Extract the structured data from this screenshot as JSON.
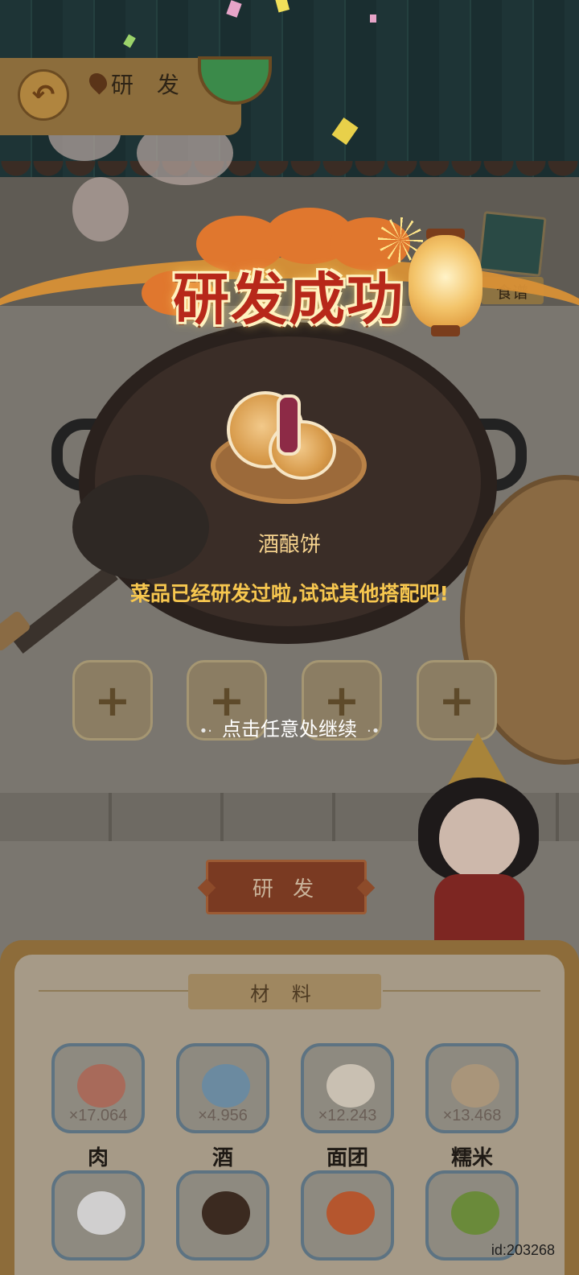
{
  "header": {
    "title": "研 发",
    "back_icon": "back-arrow-icon",
    "location_icon": "location-pin-icon"
  },
  "recipe_book": {
    "label": "食谱",
    "icon": "recipe-book-icon"
  },
  "popup": {
    "title": "研发成功",
    "dish_name": "酒酿饼",
    "message": "菜品已经研发过啦,试试其他搭配吧!",
    "continue_hint": "点击任意处继续",
    "colors": {
      "title": "#b7281a",
      "message": "#f7c74f",
      "ribbon": "#d99136"
    }
  },
  "slots": {
    "symbol": "+",
    "count": 4
  },
  "research_button": {
    "label": "研 发"
  },
  "materials": {
    "title": "材 料",
    "items": [
      {
        "name": "肉",
        "count": "×17.064",
        "icon": "meat-icon",
        "color": "#a86a5a"
      },
      {
        "name": "酒",
        "count": "×4.956",
        "icon": "wine-jar-icon",
        "color": "#6b8aa0"
      },
      {
        "name": "面团",
        "count": "×12.243",
        "icon": "dough-icon",
        "color": "#c9c0b2"
      },
      {
        "name": "糯米",
        "count": "×13.468",
        "icon": "rice-sack-icon",
        "color": "#a9957a"
      },
      {
        "name": "",
        "count": "",
        "icon": "flour-bowl-icon",
        "color": "#d0cfcf"
      },
      {
        "name": "",
        "count": "",
        "icon": "soy-sauce-jar-icon",
        "color": "#3b2a20"
      },
      {
        "name": "",
        "count": "",
        "icon": "spices-icon",
        "color": "#b5562e"
      },
      {
        "name": "",
        "count": "",
        "icon": "vegetable-basket-icon",
        "color": "#6a8a3a"
      }
    ]
  },
  "footer": {
    "id_label": "id:203268"
  }
}
